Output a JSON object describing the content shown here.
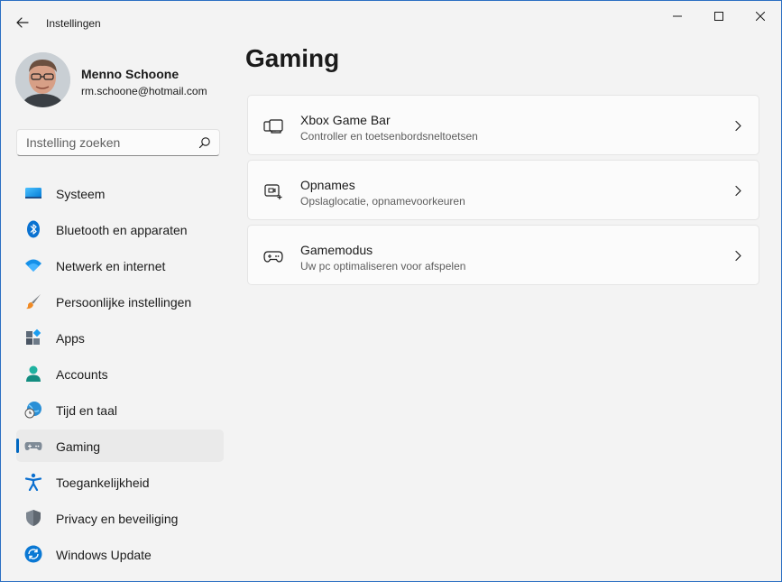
{
  "window": {
    "title": "Instellingen",
    "accent": "#0067c0"
  },
  "profile": {
    "name": "Menno Schoone",
    "email": "rm.schoone@hotmail.com"
  },
  "search": {
    "placeholder": "Instelling zoeken",
    "value": ""
  },
  "nav": {
    "items": [
      {
        "label": "Systeem",
        "icon": "system-icon",
        "selected": false
      },
      {
        "label": "Bluetooth en apparaten",
        "icon": "bluetooth-icon",
        "selected": false
      },
      {
        "label": "Netwerk en internet",
        "icon": "wifi-icon",
        "selected": false
      },
      {
        "label": "Persoonlijke instellingen",
        "icon": "brush-icon",
        "selected": false
      },
      {
        "label": "Apps",
        "icon": "apps-icon",
        "selected": false
      },
      {
        "label": "Accounts",
        "icon": "account-icon",
        "selected": false
      },
      {
        "label": "Tijd en taal",
        "icon": "globe-clock-icon",
        "selected": false
      },
      {
        "label": "Gaming",
        "icon": "gamepad-icon",
        "selected": true
      },
      {
        "label": "Toegankelijkheid",
        "icon": "accessibility-icon",
        "selected": false
      },
      {
        "label": "Privacy en beveiliging",
        "icon": "shield-icon",
        "selected": false
      },
      {
        "label": "Windows Update",
        "icon": "update-icon",
        "selected": false
      }
    ]
  },
  "main": {
    "title": "Gaming",
    "cards": [
      {
        "title": "Xbox Game Bar",
        "subtitle": "Controller en toetsenbordsneltoetsen",
        "icon": "game-bar-icon"
      },
      {
        "title": "Opnames",
        "subtitle": "Opslaglocatie, opnamevoorkeuren",
        "icon": "capture-icon"
      },
      {
        "title": "Gamemodus",
        "subtitle": "Uw pc optimaliseren voor afspelen",
        "icon": "game-mode-icon"
      }
    ]
  }
}
